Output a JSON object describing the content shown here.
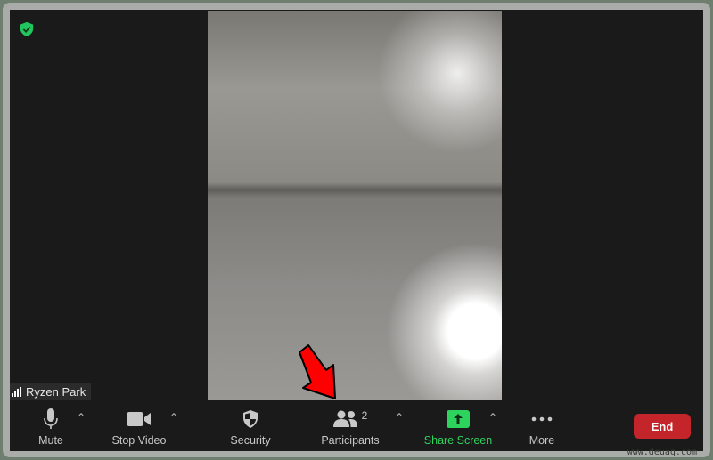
{
  "meeting": {
    "participant_name": "Ryzen Park",
    "shield_icon": "shield-check-icon"
  },
  "toolbar": {
    "mute": "Mute",
    "stop_video": "Stop Video",
    "security": "Security",
    "participants": "Participants",
    "participants_count": "2",
    "share_screen": "Share Screen",
    "more": "More",
    "end": "End"
  },
  "colors": {
    "share_green": "#2dd35c",
    "end_red": "#c4252b",
    "annotation_arrow": "#ff0000"
  },
  "watermark": "www.deuaq.com"
}
